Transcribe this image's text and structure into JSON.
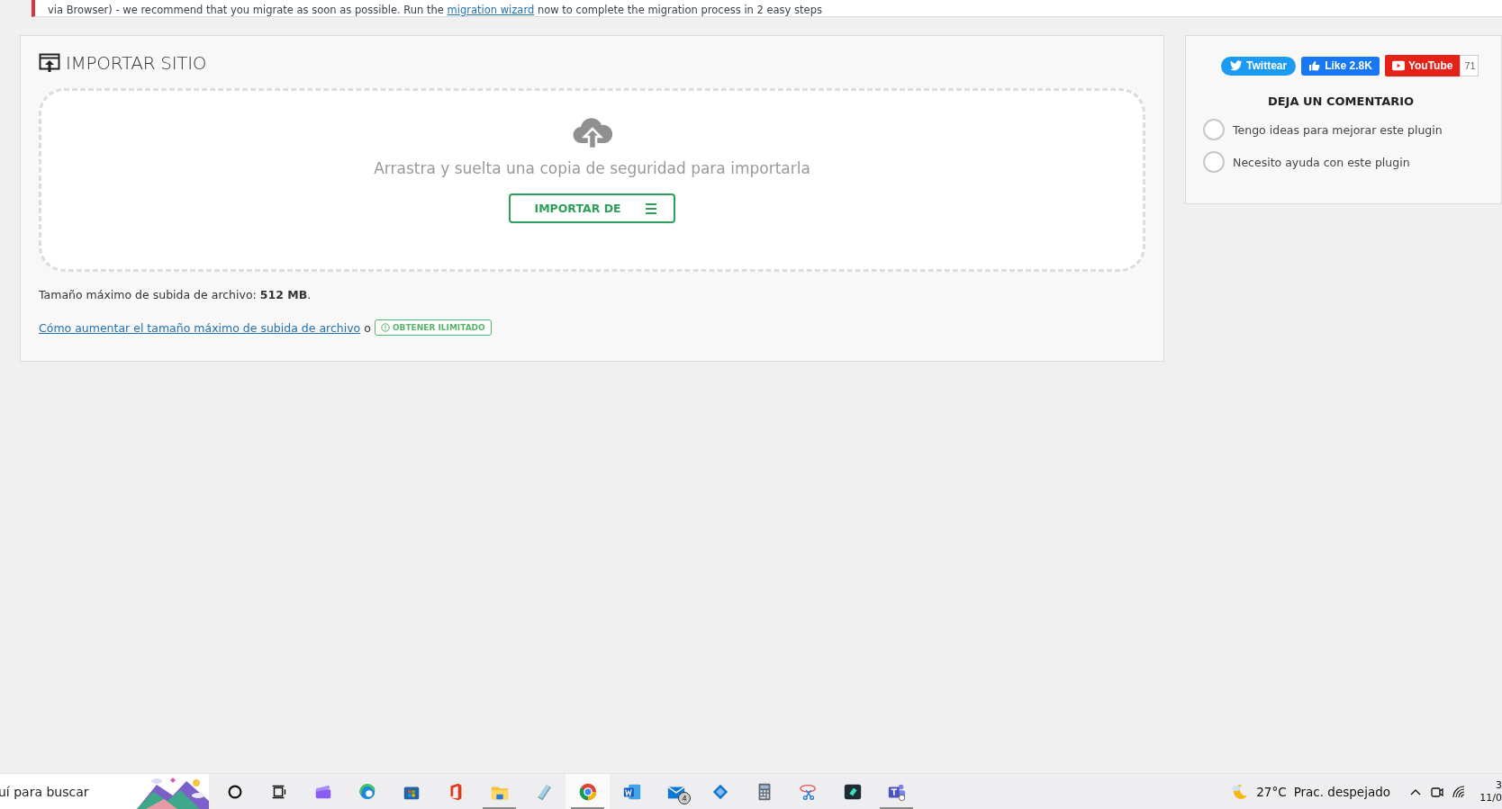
{
  "notice": {
    "text_before": "via Browser) - we recommend that you migrate as soon as possible. Run the ",
    "link": "migration wizard",
    "text_after": " now to complete the migration process in 2 easy steps"
  },
  "import_panel": {
    "title": "IMPORTAR SITIO",
    "dropzone_text": "Arrastra y suelta una copia de seguridad para importarla",
    "import_button": "IMPORTAR DE",
    "max_size_text": "Tamaño máximo de subida de archivo: **512 MB**.",
    "help_link": "Cómo aumentar el tamaño máximo de subida de archivo",
    "separator": "o",
    "unlimited_badge": "OBTENER ILIMITADO"
  },
  "social": [
    {
      "kind": "twitter",
      "label": "Twittear"
    },
    {
      "kind": "facebook",
      "label": "Like 2.8K"
    },
    {
      "kind": "youtube",
      "label": "YouTube",
      "count": "71"
    }
  ],
  "feedback": {
    "title": "DEJA UN COMENTARIO",
    "options": [
      {
        "label": "Tengo ideas para mejorar este plugin",
        "selected": false
      },
      {
        "label": "Necesito ayuda con este plugin",
        "selected": false
      }
    ]
  },
  "taskbar": {
    "search_placeholder": "uí para buscar",
    "apps": [
      {
        "kind": "cortana",
        "running": false,
        "selected": false
      },
      {
        "kind": "taskview",
        "running": false,
        "selected": false
      },
      {
        "kind": "clipchamp",
        "running": false,
        "selected": false
      },
      {
        "kind": "edge",
        "running": false,
        "selected": false
      },
      {
        "kind": "store",
        "running": false,
        "selected": false
      },
      {
        "kind": "office",
        "running": false,
        "selected": false
      },
      {
        "kind": "explorer",
        "running": true,
        "selected": false
      },
      {
        "kind": "notepad",
        "running": false,
        "selected": false
      },
      {
        "kind": "chrome",
        "running": true,
        "selected": true
      },
      {
        "kind": "word",
        "running": false,
        "selected": false
      },
      {
        "kind": "mail",
        "running": false,
        "selected": false,
        "badge": "4"
      },
      {
        "kind": "diamond",
        "running": false,
        "selected": false
      },
      {
        "kind": "calculator",
        "running": false,
        "selected": false
      },
      {
        "kind": "snipping",
        "running": false,
        "selected": false
      },
      {
        "kind": "filmora",
        "running": false,
        "selected": false
      },
      {
        "kind": "teams",
        "running": true,
        "selected": false
      }
    ],
    "weather": {
      "temperature": "27°C",
      "condition": "Prac. despejado"
    },
    "clock": {
      "time": "3",
      "date": "11/0"
    }
  }
}
